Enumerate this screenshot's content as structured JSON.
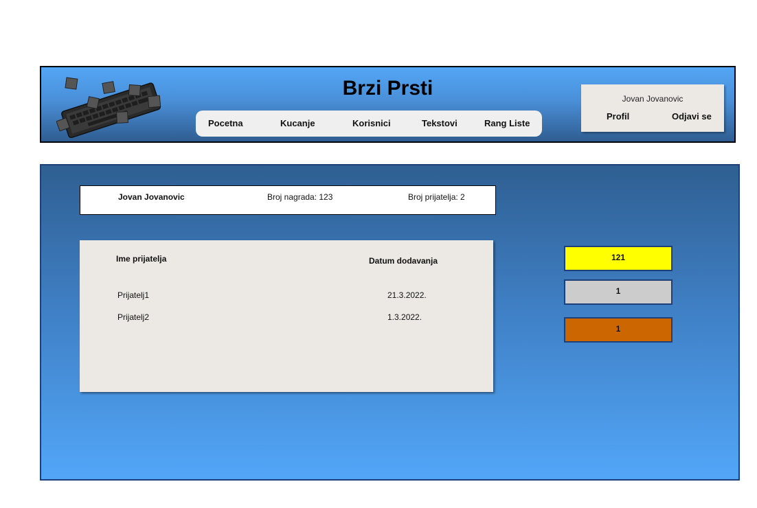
{
  "header": {
    "title": "Brzi Prsti",
    "nav": [
      {
        "label": "Pocetna"
      },
      {
        "label": "Kucanje"
      },
      {
        "label": "Korisnici"
      },
      {
        "label": "Tekstovi"
      },
      {
        "label": "Rang Liste"
      }
    ],
    "user": {
      "name": "Jovan Jovanovic",
      "profile_label": "Profil",
      "logout_label": "Odjavi se"
    }
  },
  "profile": {
    "name": "Jovan Jovanovic",
    "awards_text": "Broj nagrada: 123",
    "friends_text": "Broj prijatelja: 2"
  },
  "friends": {
    "columns": [
      "Ime prijatelja",
      "Datum dodavanja"
    ],
    "rows": [
      {
        "name": "Prijatelj1",
        "date": "21.3.2022."
      },
      {
        "name": "Prijatelj2",
        "date": "1.3.2022."
      }
    ]
  },
  "awards": [
    {
      "label": "gold",
      "count": "121",
      "color": "#ffff00"
    },
    {
      "label": "silver",
      "count": "1",
      "color": "#cccccc"
    },
    {
      "label": "bronze",
      "count": "1",
      "color": "#cc6600"
    }
  ]
}
